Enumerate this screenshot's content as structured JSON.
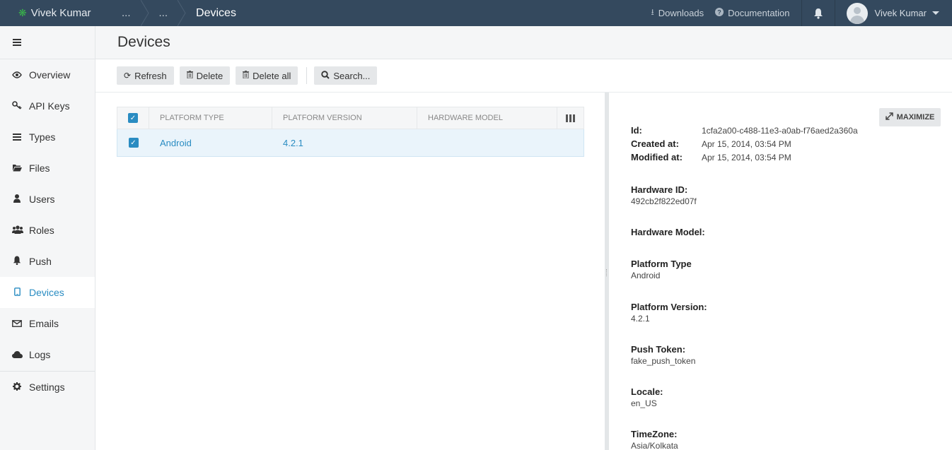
{
  "topbar": {
    "app_name": "Vivek Kumar",
    "breadcrumbs": [
      "...",
      "...",
      "Devices"
    ],
    "downloads_label": "Downloads",
    "documentation_label": "Documentation",
    "user_name": "Vivek Kumar"
  },
  "sidebar": {
    "items": [
      {
        "label": "Overview",
        "icon": "eye-icon"
      },
      {
        "label": "API Keys",
        "icon": "key-icon"
      },
      {
        "label": "Types",
        "icon": "list-icon"
      },
      {
        "label": "Files",
        "icon": "folder-icon"
      },
      {
        "label": "Users",
        "icon": "user-icon"
      },
      {
        "label": "Roles",
        "icon": "group-icon"
      },
      {
        "label": "Push",
        "icon": "bell-icon"
      },
      {
        "label": "Devices",
        "icon": "mobile-icon",
        "active": true
      },
      {
        "label": "Emails",
        "icon": "envelope-icon"
      },
      {
        "label": "Logs",
        "icon": "cloud-icon"
      },
      {
        "label": "Settings",
        "icon": "gear-icon"
      }
    ]
  },
  "page": {
    "title": "Devices"
  },
  "toolbar": {
    "refresh_label": "Refresh",
    "delete_label": "Delete",
    "delete_all_label": "Delete all",
    "search_label": "Search..."
  },
  "grid": {
    "columns": [
      "PLATFORM TYPE",
      "PLATFORM VERSION",
      "HARDWARE MODEL"
    ],
    "rows": [
      {
        "platform_type": "Android",
        "platform_version": "4.2.1",
        "hardware_model": "",
        "selected": true
      }
    ]
  },
  "detail": {
    "maximize_label": "MAXIMIZE",
    "id_label": "Id:",
    "id_value": "1cfa2a00-c488-11e3-a0ab-f76aed2a360a",
    "created_label": "Created at:",
    "created_value": "Apr 15, 2014, 03:54 PM",
    "modified_label": "Modified at:",
    "modified_value": "Apr 15, 2014, 03:54 PM",
    "fields": [
      {
        "label": "Hardware ID:",
        "value": "492cb2f822ed07f"
      },
      {
        "label": "Hardware Model:",
        "value": ""
      },
      {
        "label": "Platform Type",
        "value": "Android"
      },
      {
        "label": "Platform Version:",
        "value": "4.2.1"
      },
      {
        "label": "Push Token:",
        "value": "fake_push_token"
      },
      {
        "label": "Locale:",
        "value": "en_US"
      },
      {
        "label": "TimeZone:",
        "value": "Asia/Kolkata"
      }
    ]
  },
  "colors": {
    "topbar": "#34495e",
    "accent": "#2a8cc2",
    "brand_logo": "#39b54a"
  }
}
